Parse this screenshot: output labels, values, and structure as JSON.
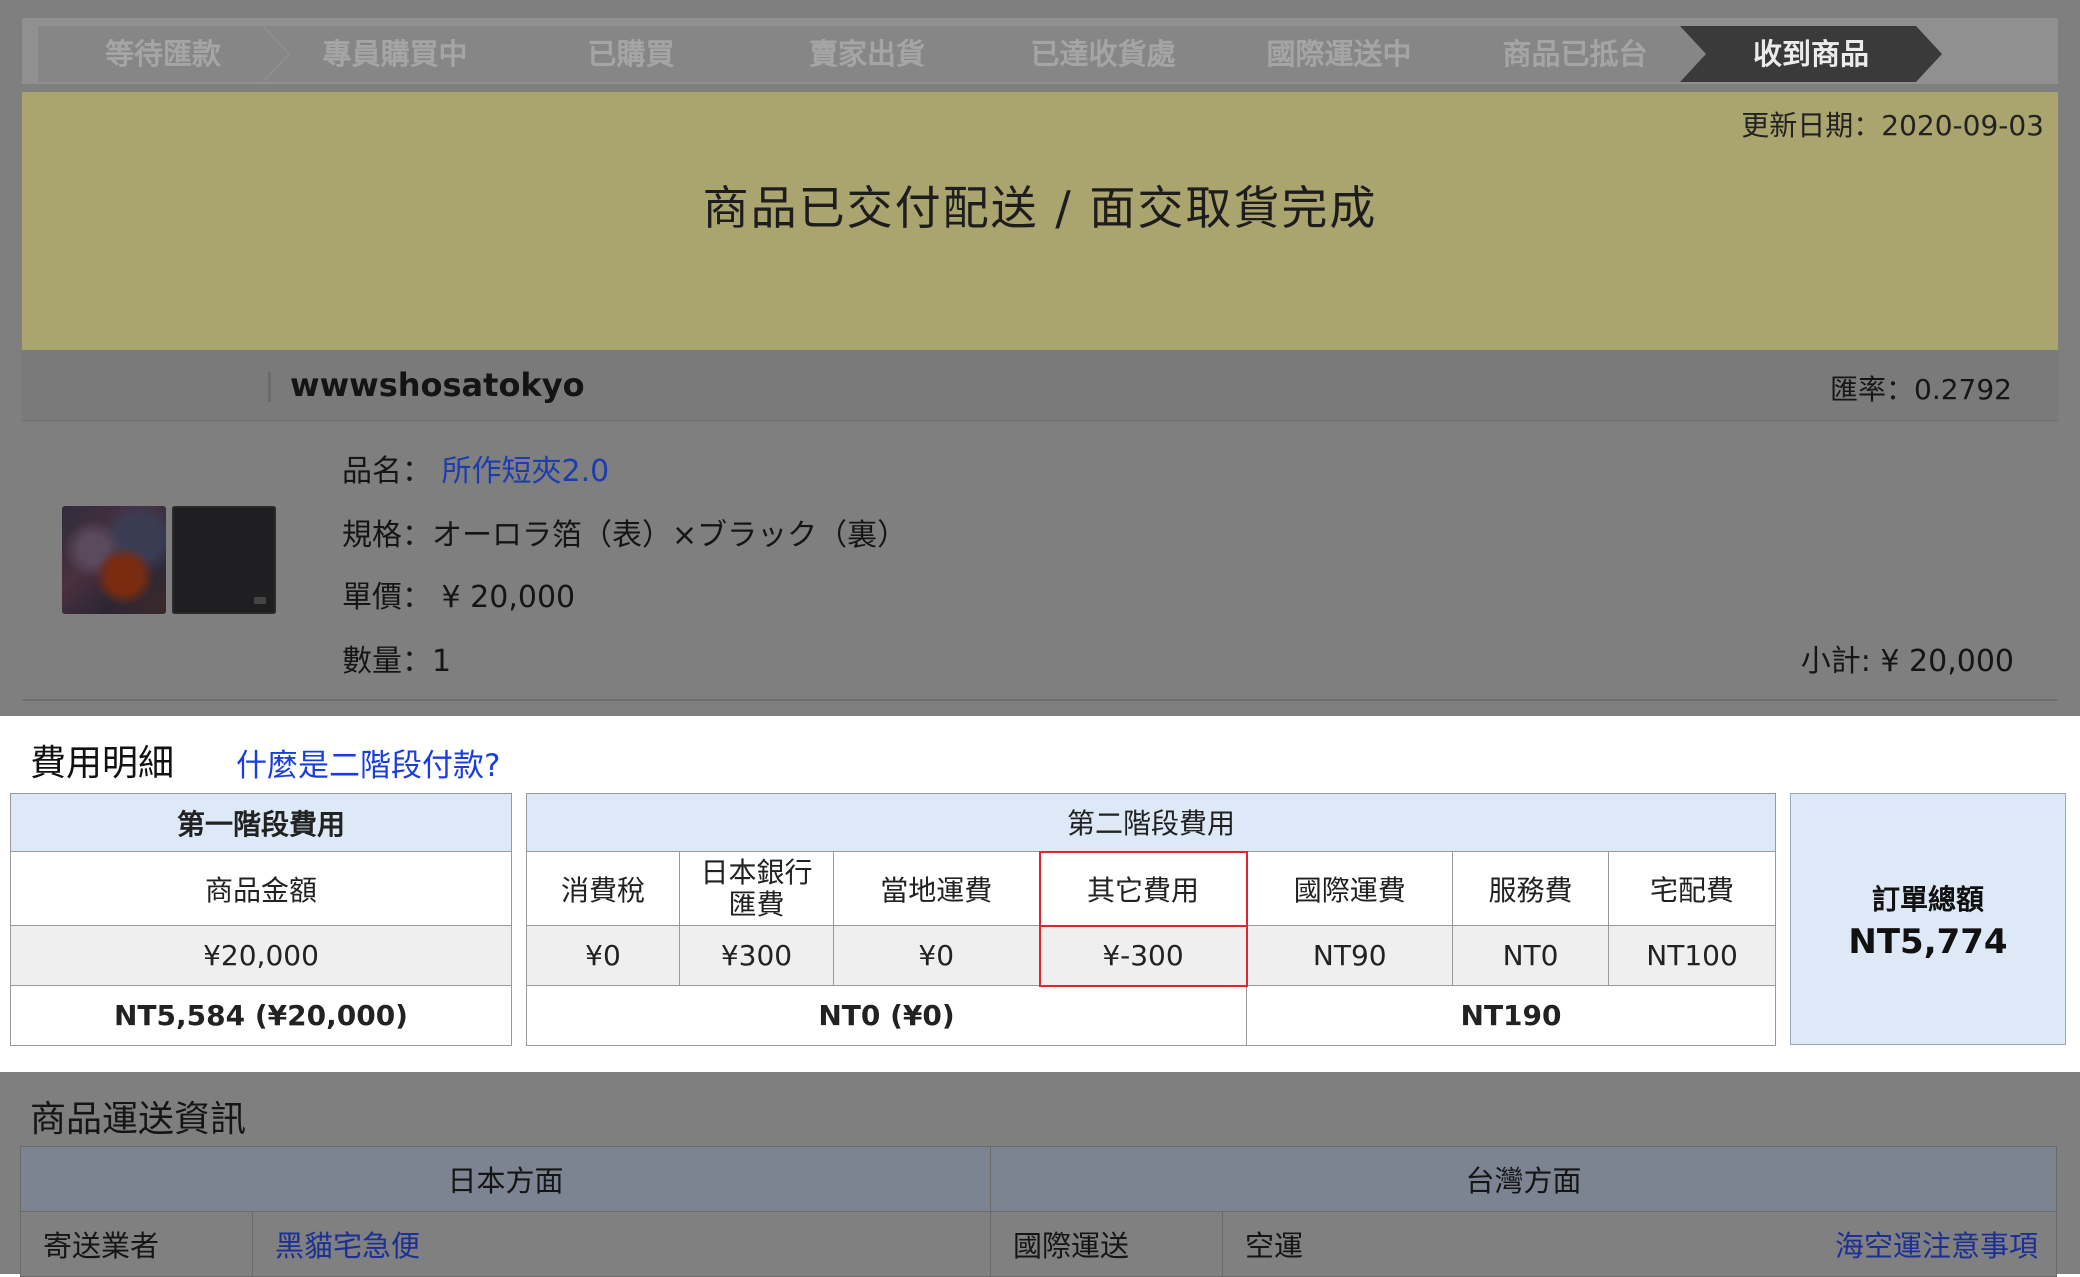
{
  "steps": [
    "等待匯款",
    "專員購買中",
    "已購買",
    "賣家出貨",
    "已達收貨處",
    "國際運送中",
    "商品已抵台",
    "收到商品"
  ],
  "status": {
    "update_date": "更新日期：2020-09-03",
    "message": "商品已交付配送 / 面交取貨完成"
  },
  "seller": {
    "name": "wwwshosatokyo",
    "rate": "匯率：0.2792"
  },
  "product": {
    "name_label": "品名：",
    "name_value": "所作短夾2.0",
    "spec": "規格：オーロラ箔（表）×ブラック（裏）",
    "unit_price": "單價： ¥ 20,000",
    "quantity": "數量：1",
    "subtotal": "小計: ¥ 20,000"
  },
  "cost": {
    "title": "費用明細",
    "help_link": "什麼是二階段付款?",
    "stage1": {
      "header": "第一階段費用",
      "col": "商品金額",
      "value": "¥20,000",
      "total": "NT5,584 (¥20,000)"
    },
    "stage2": {
      "header": "第二階段費用",
      "cols": [
        "消費稅",
        "日本銀行匯費",
        "當地運費",
        "其它費用",
        "國際運費",
        "服務費",
        "宅配費"
      ],
      "values": [
        "¥0",
        "¥300",
        "¥0",
        "¥-300",
        "NT90",
        "NT0",
        "NT100"
      ],
      "subtotal_jp": "NT0 (¥0)",
      "subtotal_tw": "NT190"
    },
    "order_total_label": "訂單總額",
    "order_total_value": "NT5,774",
    "highlight_color": "#e0262b"
  },
  "shipping": {
    "title": "商品運送資訊",
    "jp_header": "日本方面",
    "tw_header": "台灣方面",
    "carrier_label": "寄送業者",
    "carrier_value": "黑貓宅急便",
    "intl_label": "國際運送",
    "intl_value": "空運",
    "notice_link": "海空運注意事項"
  }
}
